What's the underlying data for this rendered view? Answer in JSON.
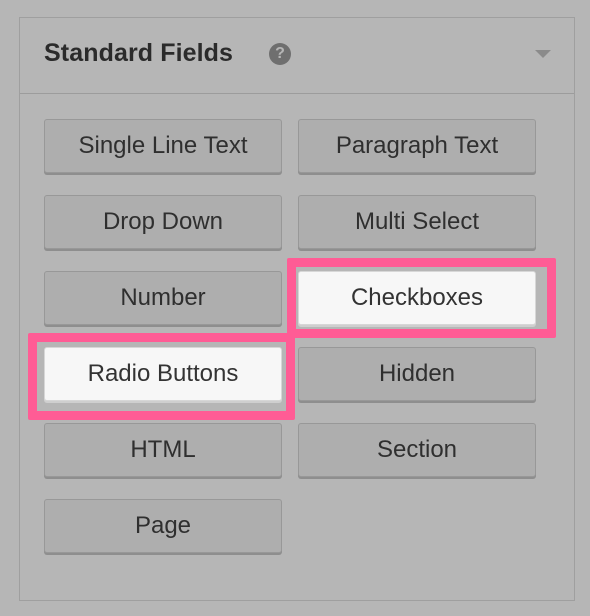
{
  "panel": {
    "title": "Standard Fields",
    "help_icon": "question-circle-icon",
    "toggle_icon": "caret-down-icon",
    "help_glyph": "?"
  },
  "fields": [
    {
      "label": "Single Line Text",
      "state": "default"
    },
    {
      "label": "Paragraph Text",
      "state": "default"
    },
    {
      "label": "Drop Down",
      "state": "default"
    },
    {
      "label": "Multi Select",
      "state": "default"
    },
    {
      "label": "Number",
      "state": "default"
    },
    {
      "label": "Checkboxes",
      "state": "highlighted"
    },
    {
      "label": "Radio Buttons",
      "state": "highlighted"
    },
    {
      "label": "Hidden",
      "state": "default"
    },
    {
      "label": "HTML",
      "state": "default"
    },
    {
      "label": "Section",
      "state": "default"
    },
    {
      "label": "Page",
      "state": "default"
    }
  ],
  "colors": {
    "background": "#b6b6b6",
    "highlight": "#ff5c95",
    "highlighted_button": "#f7f7f7"
  }
}
